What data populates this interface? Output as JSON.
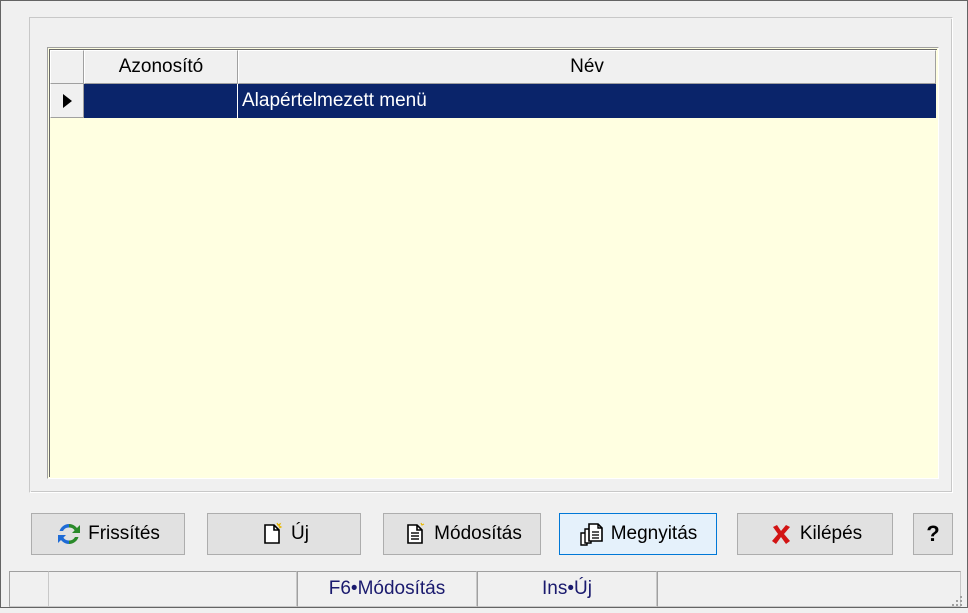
{
  "grid": {
    "columns": [
      "Azonosító",
      "Név"
    ],
    "rows": [
      {
        "azonosito": "",
        "nev": "Alapértelmezett menü",
        "selected": true
      }
    ],
    "background": "#ffffe1",
    "selection_color": "#0a246a"
  },
  "buttons": {
    "refresh": "Frissítés",
    "new": "Új",
    "edit": "Módosítás",
    "open": "Megnyitás",
    "exit": "Kilépés",
    "help": "?"
  },
  "icons": {
    "refresh": "refresh-icon",
    "new": "new-document-icon",
    "edit": "edit-document-icon",
    "open": "open-documents-icon",
    "exit": "red-x-icon",
    "row_indicator": "row-pointer-icon"
  },
  "statusbar": {
    "panels": [
      "",
      "F6•Módosítás",
      "Ins•Új",
      ""
    ]
  }
}
